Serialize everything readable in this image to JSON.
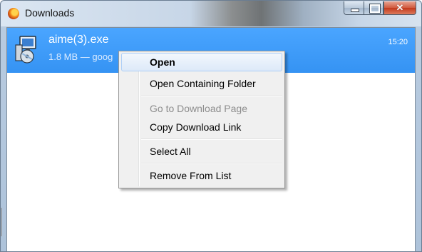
{
  "window": {
    "title": "Downloads",
    "icon": "firefox-icon",
    "caption_buttons": {
      "minimize": "minimize-icon",
      "maximize": "maximize-icon",
      "close": "✕"
    }
  },
  "downloads": [
    {
      "filename": "aime(3).exe",
      "status": "1.8 MB — goog",
      "time": "15:20",
      "icon": "installer-icon",
      "selected": true
    }
  ],
  "context_menu": {
    "items": [
      {
        "label": "Open",
        "highlighted": true,
        "bold": true,
        "enabled": true
      },
      {
        "label": "Open Containing Folder",
        "enabled": true
      },
      {
        "label": "Go to Download Page",
        "enabled": false
      },
      {
        "label": "Copy Download Link",
        "enabled": true
      },
      {
        "label": "Select All",
        "enabled": true
      },
      {
        "label": "Remove From List",
        "enabled": true
      }
    ]
  },
  "colors": {
    "selection": "#3399ff",
    "menu_background": "#f0f0f0",
    "menu_highlight_border": "#aecff7",
    "disabled_text": "#8d8d8d"
  }
}
